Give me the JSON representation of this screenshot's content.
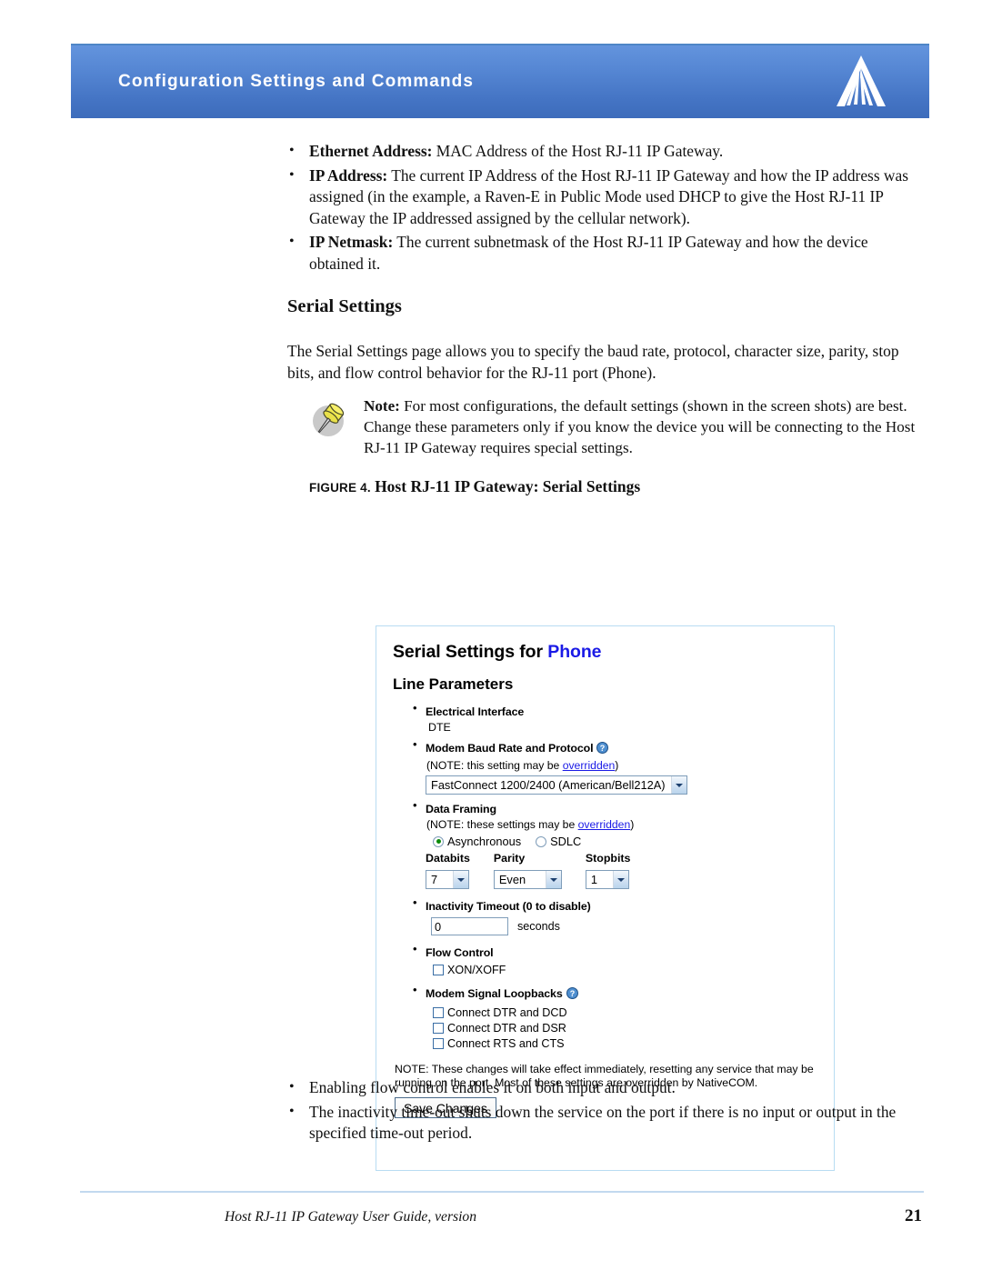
{
  "header": {
    "title": "Configuration Settings and Commands",
    "logo_icon": "sierra-wireless-logo-icon"
  },
  "top_bullets": [
    {
      "term": "Ethernet Address:",
      "text": " MAC Address of the Host RJ-11 IP Gateway."
    },
    {
      "term": "IP Address:",
      "text": " The current IP Address of the Host RJ-11 IP Gateway and how the IP address was assigned (in the example, a Raven-E in Public Mode used DHCP to give the Host RJ-11 IP Gateway the IP addressed assigned by the cellular network)."
    },
    {
      "term": "IP Netmask:",
      "text": " The current subnetmask of the Host RJ-11 IP Gateway and how the device obtained it."
    }
  ],
  "section": {
    "heading": "Serial Settings",
    "intro": "The Serial Settings page allows you to specify the baud rate, protocol, character size, parity, stop bits, and flow control behavior for the RJ-11 port (Phone)."
  },
  "note": {
    "icon": "pushpin-icon",
    "term": "Note:",
    "text": " For most configurations, the default settings (shown in the screen shots) are best. Change these parameters only if you know the device you will be connecting to the Host RJ-11 IP Gateway requires special settings."
  },
  "figure": {
    "label": "FIGURE 4.",
    "title": "Host RJ-11 IP Gateway: Serial Settings"
  },
  "screenshot": {
    "title_prefix": "Serial Settings for ",
    "title_highlight": "Phone",
    "subheading": "Line Parameters",
    "electrical_interface": {
      "label": "Electrical Interface",
      "value": "DTE"
    },
    "baud_rate": {
      "label": "Modem Baud Rate and Protocol",
      "help_icon": "help-question-icon",
      "note_prefix": "(NOTE: this setting may be ",
      "note_link": "overridden",
      "note_suffix": ")",
      "selected": "FastConnect 1200/2400 (American/Bell212A)",
      "dropdown_icon": "chevron-down-icon"
    },
    "data_framing": {
      "label": "Data Framing",
      "note_prefix": "(NOTE: these settings may be ",
      "note_link": "overridden",
      "note_suffix": ")",
      "options": [
        {
          "label": "Asynchronous",
          "selected": true
        },
        {
          "label": "SDLC",
          "selected": false
        }
      ],
      "fields": [
        {
          "header": "Databits",
          "value": "7"
        },
        {
          "header": "Parity",
          "value": "Even"
        },
        {
          "header": "Stopbits",
          "value": "1"
        }
      ]
    },
    "inactivity_timeout": {
      "label": "Inactivity Timeout (0 to disable)",
      "value": "0",
      "unit": "seconds"
    },
    "flow_control": {
      "label": "Flow Control",
      "checkbox_label": "XON/XOFF",
      "checked": false
    },
    "loopbacks": {
      "label": "Modem Signal Loopbacks",
      "help_icon": "help-question-icon",
      "items": [
        {
          "label": "Connect DTR and DCD",
          "checked": false
        },
        {
          "label": "Connect DTR and DSR",
          "checked": false
        },
        {
          "label": "Connect RTS and CTS",
          "checked": false
        }
      ]
    },
    "footnote": "NOTE: These changes will take effect immediately, resetting any service that may be running on the port. Most of these settings are overridden by NativeCOM.",
    "save_button": "Save Changes"
  },
  "bottom_bullets": [
    "Enabling flow control enables it on both input and output.",
    "The inactivity time-out shuts down the service on the port if there is no input or output in the specified time-out period."
  ],
  "footer": {
    "left": "Host RJ-11 IP Gateway User Guide, version",
    "page_number": "21"
  },
  "colors": {
    "header_blue_light": "#6394dd",
    "header_blue_dark": "#3d6cbb",
    "link_blue": "#1a1ae6",
    "figure_border": "#b8dcf2",
    "footer_rule": "#c2d9ef",
    "pushpin_yellow": "#f2ec55"
  }
}
